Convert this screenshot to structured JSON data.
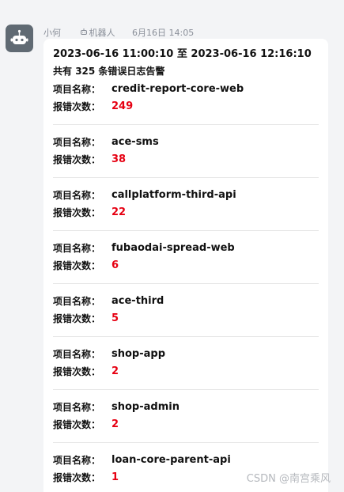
{
  "message": {
    "sender": "小何",
    "tag": "机器人",
    "time": "6月16日 14:05",
    "range": "2023-06-16 11:00:10 至 2023-06-16 12:16:10",
    "summary_prefix": "共有 ",
    "summary_count": "325",
    "summary_suffix": " 条错误日志告警",
    "project_label": "项目名称：",
    "count_label": "报错次数：",
    "projects": [
      {
        "name": "credit-report-core-web",
        "count": "249"
      },
      {
        "name": "ace-sms",
        "count": "38"
      },
      {
        "name": "callplatform-third-api",
        "count": "22"
      },
      {
        "name": "fubaodai-spread-web",
        "count": "6"
      },
      {
        "name": "ace-third",
        "count": "5"
      },
      {
        "name": "shop-app",
        "count": "2"
      },
      {
        "name": "shop-admin",
        "count": "2"
      },
      {
        "name": "loan-core-parent-api",
        "count": "1"
      }
    ]
  },
  "watermark": "CSDN @南宫乘风",
  "colors": {
    "accent_red": "#e60012",
    "avatar_bg": "#606a73"
  }
}
